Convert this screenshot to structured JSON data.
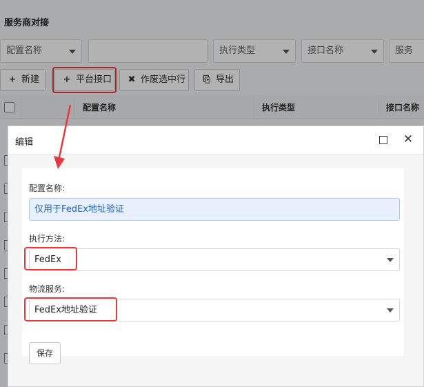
{
  "page": {
    "title": "服务商对接"
  },
  "filters": {
    "config_name": "配置名称",
    "text_input": "",
    "exec_type": "执行类型",
    "interface_name": "接口名称",
    "service": "服务"
  },
  "toolbar": {
    "new_label": "新建",
    "platform_label": "平台接口",
    "void_label": "作废选中行",
    "export_label": "导出"
  },
  "table": {
    "columns": [
      "配置名称",
      "执行类型",
      "接口名称"
    ]
  },
  "modal": {
    "title": "编辑",
    "fields": {
      "config_name_label": "配置名称:",
      "config_name_value": "仅用于FedEx地址验证",
      "exec_method_label": "执行方法:",
      "exec_method_value": "FedEx",
      "logistics_label": "物流服务:",
      "logistics_value": "FedEx地址验证"
    },
    "save_label": "保存"
  },
  "colors": {
    "highlight": "#e8383d",
    "link_blue": "#1b62c4",
    "autofill_bg": "#e8f0fe"
  }
}
